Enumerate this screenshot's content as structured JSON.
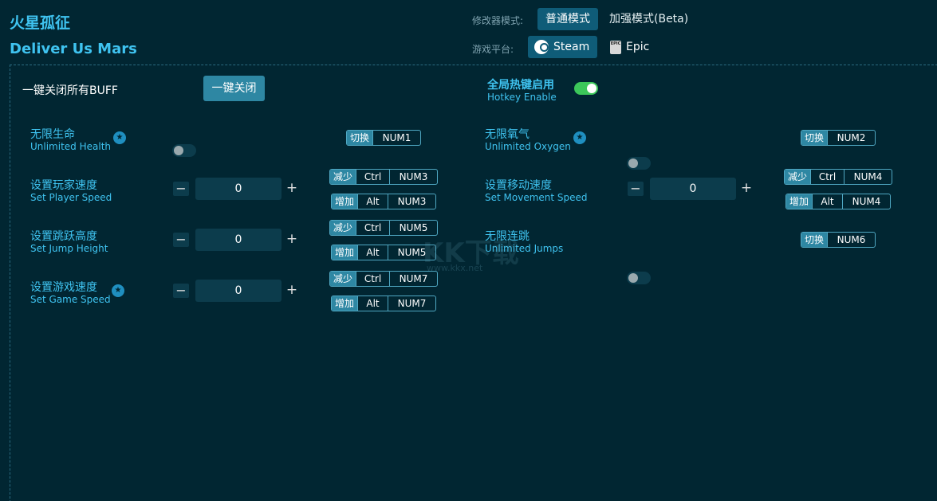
{
  "header": {
    "title_cn": "火星孤征",
    "title_en": "Deliver Us Mars",
    "mode_label": "修改器模式:",
    "mode_normal": "普通模式",
    "mode_enhanced": "加强模式(Beta)",
    "platform_label": "游戏平台:",
    "platform_steam": "Steam",
    "platform_epic": "Epic",
    "epic_icon_text": "EPIC"
  },
  "toolbar": {
    "close_all_label": "一键关闭所有BUFF",
    "close_all_button": "一键关闭",
    "hotkey_cn": "全局热键启用",
    "hotkey_en": "Hotkey Enable",
    "hotkey_enabled": true
  },
  "options": {
    "health": {
      "cn": "无限生命",
      "en": "Unlimited Health",
      "key_label": "切换",
      "key": "NUM1"
    },
    "oxygen": {
      "cn": "无限氧气",
      "en": "Unlimited Oxygen",
      "key_label": "切换",
      "key": "NUM2"
    },
    "player_speed": {
      "cn": "设置玩家速度",
      "en": "Set Player Speed",
      "value": "0",
      "dec_label": "减少",
      "dec_mod": "Ctrl",
      "dec_key": "NUM3",
      "inc_label": "增加",
      "inc_mod": "Alt",
      "inc_key": "NUM3"
    },
    "move_speed": {
      "cn": "设置移动速度",
      "en": "Set Movement Speed",
      "value": "0",
      "dec_label": "减少",
      "dec_mod": "Ctrl",
      "dec_key": "NUM4",
      "inc_label": "增加",
      "inc_mod": "Alt",
      "inc_key": "NUM4"
    },
    "jump_height": {
      "cn": "设置跳跃高度",
      "en": "Set Jump Height",
      "value": "0",
      "dec_label": "减少",
      "dec_mod": "Ctrl",
      "dec_key": "NUM5",
      "inc_label": "增加",
      "inc_mod": "Alt",
      "inc_key": "NUM5"
    },
    "jumps": {
      "cn": "无限连跳",
      "en": "Unlimited Jumps",
      "key_label": "切换",
      "key": "NUM6"
    },
    "game_speed": {
      "cn": "设置游戏速度",
      "en": "Set Game Speed",
      "value": "0",
      "dec_label": "减少",
      "dec_mod": "Ctrl",
      "dec_key": "NUM7",
      "inc_label": "增加",
      "inc_mod": "Alt",
      "inc_key": "NUM7"
    }
  },
  "stepper": {
    "minus": "−",
    "plus": "+"
  },
  "watermark": {
    "text": "KK下载",
    "url": "www.kkx.net"
  },
  "colors": {
    "background": "#012632",
    "accent": "#3fc3f0",
    "button": "#2e87a3",
    "toggle_on": "#3cc75a"
  }
}
